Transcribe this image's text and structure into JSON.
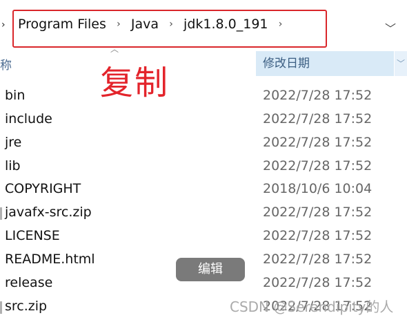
{
  "address_bar": {
    "crumbs": [
      "Program Files",
      "Java",
      "jdk1.8.0_191"
    ],
    "separator_icon": "chevron-right",
    "dropdown_icon": "chevron-down"
  },
  "annotation": {
    "text": "复制",
    "color": "#e3242b"
  },
  "columns": {
    "name_label": "称",
    "date_label": "修改日期"
  },
  "files": [
    {
      "name": "bin",
      "date": "2022/7/28 17:52"
    },
    {
      "name": "include",
      "date": "2022/7/28 17:52"
    },
    {
      "name": "jre",
      "date": "2022/7/28 17:52"
    },
    {
      "name": "lib",
      "date": "2022/7/28 17:52"
    },
    {
      "name": "COPYRIGHT",
      "date": "2018/10/6 10:04"
    },
    {
      "name": "javafx-src.zip",
      "date": "2022/7/28 17:52"
    },
    {
      "name": "LICENSE",
      "date": "2022/7/28 17:52"
    },
    {
      "name": "README.html",
      "date": "2022/7/28 17:52"
    },
    {
      "name": "release",
      "date": "2022/7/28 17:52"
    },
    {
      "name": "src.zip",
      "date": "2022/7/28 17:52"
    }
  ],
  "tooltip": "编辑",
  "watermark": "CSDN @Serendipity的人",
  "colors": {
    "header_selected": "#d9eaf7",
    "highlight": "#d9262a"
  }
}
